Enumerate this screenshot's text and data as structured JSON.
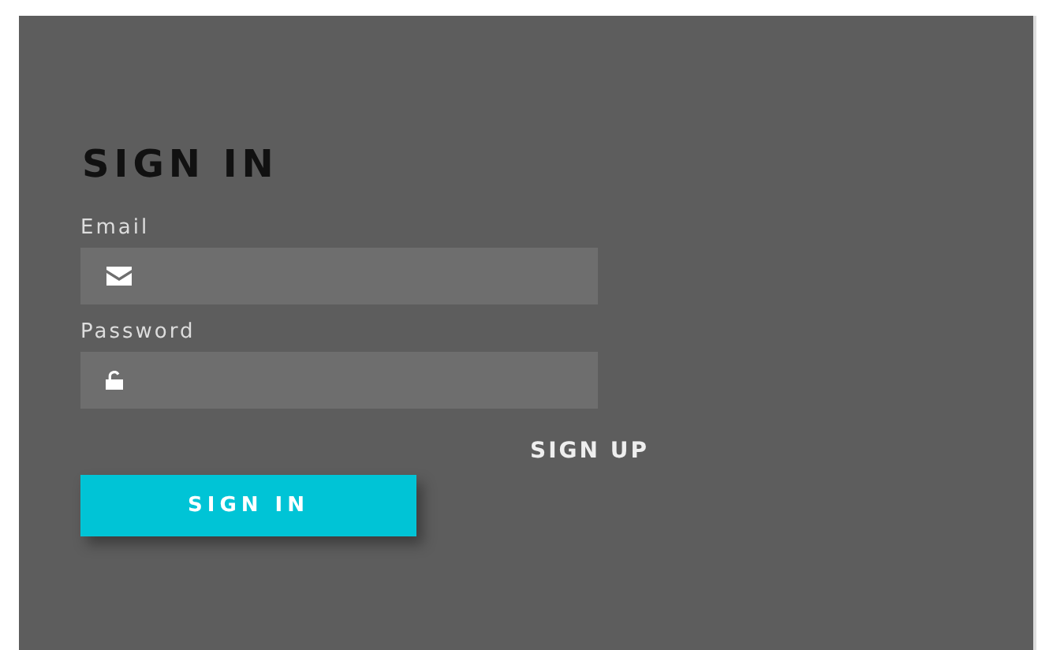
{
  "title": "SIGN IN",
  "fields": [
    {
      "label": "Email",
      "kind": "email"
    },
    {
      "label": "Password",
      "kind": "password"
    }
  ],
  "sign_up_link": "SIGN UP",
  "submit_button": "SIGN IN"
}
